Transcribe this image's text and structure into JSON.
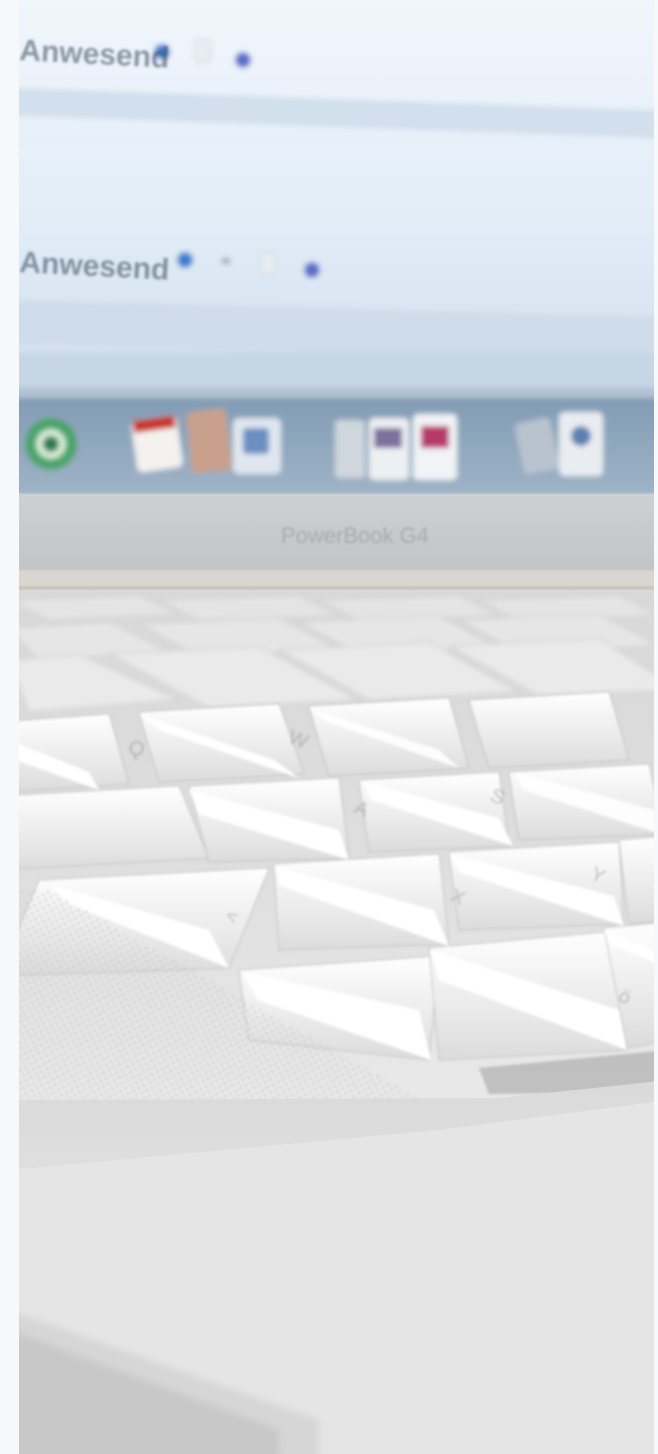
{
  "scene": {
    "description_visible_text": "",
    "colors": {
      "screen_top": "#eaf3fb",
      "screen_mid": "#d9e7f4",
      "dock": "#8fa7bd",
      "bezel": "#c9c9c9",
      "key_white": "#eeeeee",
      "key_shadow": "#bdbdbd",
      "palm_rest": "#e4e4e4"
    }
  },
  "screen": {
    "row_1_text": "Anwesend",
    "row_2_text": "Anwesend"
  },
  "bezel": {
    "logo_text": "PowerBook G4"
  },
  "keyboard": {
    "visible_key_legends": [
      "Q",
      "W",
      "A",
      "S",
      "Y",
      "X",
      "<",
      "ö"
    ]
  }
}
